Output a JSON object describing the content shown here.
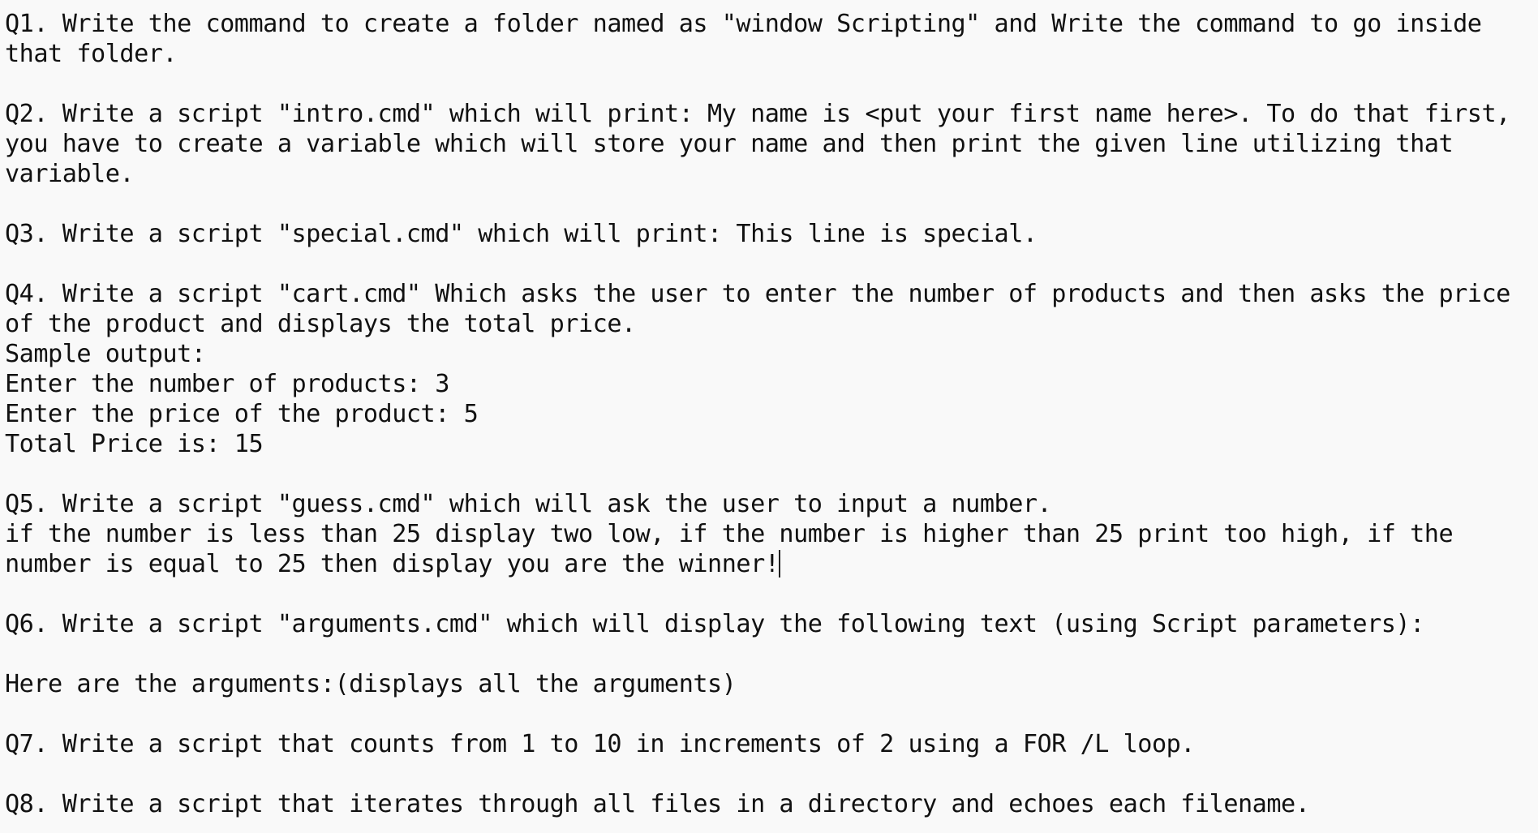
{
  "document": {
    "lines": [
      "Q1. Write the command to create a folder named as \"window Scripting\" and Write the command to go inside",
      "that folder.",
      "",
      "Q2. Write a script \"intro.cmd\" which will print: My name is <put your first name here>. To do that first,",
      "you have to create a variable which will store your name and then print the given line utilizing that",
      "variable.",
      "",
      "Q3. Write a script \"special.cmd\" which will print: This line is special.",
      "",
      "Q4. Write a script \"cart.cmd\" Which asks the user to enter the number of products and then asks the price",
      "of the product and displays the total price.",
      "Sample output:",
      "Enter the number of products: 3",
      "Enter the price of the product: 5",
      "Total Price is: 15",
      "",
      "Q5. Write a script \"guess.cmd\" which will ask the user to input a number.",
      "if the number is less than 25 display two low, if the number is higher than 25 print too high, if the",
      "number is equal to 25 then display you are the winner!",
      "",
      "Q6. Write a script \"arguments.cmd\" which will display the following text (using Script parameters):",
      "",
      "Here are the arguments:(displays all the arguments)",
      "",
      "Q7. Write a script that counts from 1 to 10 in increments of 2 using a FOR /L loop.",
      "",
      "Q8. Write a script that iterates through all files in a directory and echoes each filename."
    ]
  }
}
